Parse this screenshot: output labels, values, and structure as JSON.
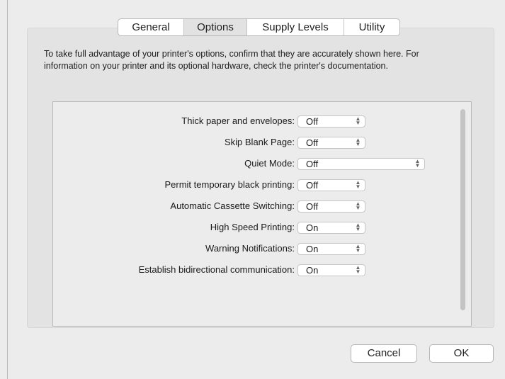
{
  "tabs": [
    {
      "label": "General",
      "active": false
    },
    {
      "label": "Options",
      "active": true
    },
    {
      "label": "Supply Levels",
      "active": false
    },
    {
      "label": "Utility",
      "active": false
    }
  ],
  "description": "To take full advantage of your printer's options, confirm that they are accurately shown here. For information on your printer and its optional hardware, check the printer's documentation.",
  "options": [
    {
      "label": "Thick paper and envelopes:",
      "value": "Off"
    },
    {
      "label": "Skip Blank Page:",
      "value": "Off"
    },
    {
      "label": "Quiet Mode:",
      "value": "Off"
    },
    {
      "label": "Permit temporary black printing:",
      "value": "Off"
    },
    {
      "label": "Automatic Cassette Switching:",
      "value": "Off"
    },
    {
      "label": "High Speed Printing:",
      "value": "On"
    },
    {
      "label": "Warning Notifications:",
      "value": "On"
    },
    {
      "label": "Establish bidirectional communication:",
      "value": "On"
    }
  ],
  "buttons": {
    "cancel": "Cancel",
    "ok": "OK"
  },
  "icons": {
    "select_arrows": "updown-chevron-icon"
  }
}
